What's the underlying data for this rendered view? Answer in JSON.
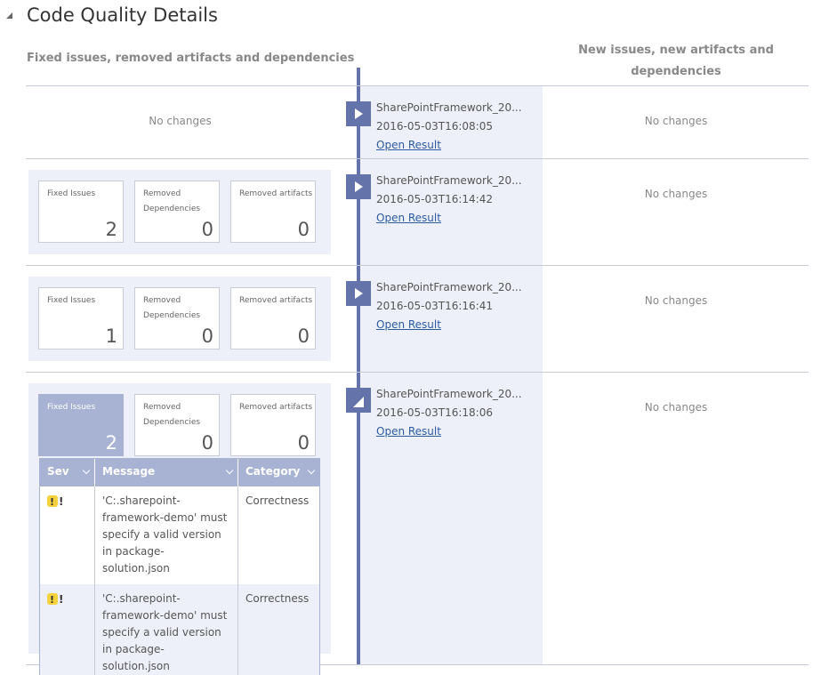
{
  "page": {
    "title": "Code Quality Details",
    "left_header": "Fixed issues, removed artifacts and dependencies",
    "right_header": "New issues, new artifacts and dependencies"
  },
  "rows": [
    {
      "left_no_changes": "No changes",
      "right_no_changes": "No changes",
      "run_name": "SharePointFramework_20...",
      "run_time": "2016-05-03T16:08:05",
      "open_result": "Open Result"
    },
    {
      "cards": [
        {
          "label": "Fixed Issues",
          "value": "2"
        },
        {
          "label": "Removed Dependencies",
          "value": "0"
        },
        {
          "label": "Removed artifacts",
          "value": "0"
        }
      ],
      "right_no_changes": "No changes",
      "run_name": "SharePointFramework_20...",
      "run_time": "2016-05-03T16:14:42",
      "open_result": "Open Result"
    },
    {
      "cards": [
        {
          "label": "Fixed Issues",
          "value": "1"
        },
        {
          "label": "Removed Dependencies",
          "value": "0"
        },
        {
          "label": "Removed artifacts",
          "value": "0"
        }
      ],
      "right_no_changes": "No changes",
      "run_name": "SharePointFramework_20...",
      "run_time": "2016-05-03T16:16:41",
      "open_result": "Open Result"
    },
    {
      "cards": [
        {
          "label": "Fixed Issues",
          "value": "2"
        },
        {
          "label": "Removed Dependencies",
          "value": "0"
        },
        {
          "label": "Removed artifacts",
          "value": "0"
        }
      ],
      "right_no_changes": "No changes",
      "run_name": "SharePointFramework_20...",
      "run_time": "2016-05-03T16:18:06",
      "open_result": "Open Result",
      "table": {
        "columns": [
          "Sev",
          "Message",
          "Category"
        ],
        "rows": [
          {
            "message": "'C:.sharepoint-framework-demo' must specify a valid version in package-solution.json",
            "category": "Correctness",
            "sev_icon": "warning-icon"
          },
          {
            "message": "'C:.sharepoint-framework-demo' must specify a valid version in package-solution.json",
            "category": "Correctness",
            "sev_icon": "warning-icon"
          }
        ]
      }
    }
  ],
  "colors": {
    "accent": "#6474ab",
    "selected_card": "#a8b3d3",
    "band": "#eef0f9",
    "warning": "#f3d23c"
  }
}
